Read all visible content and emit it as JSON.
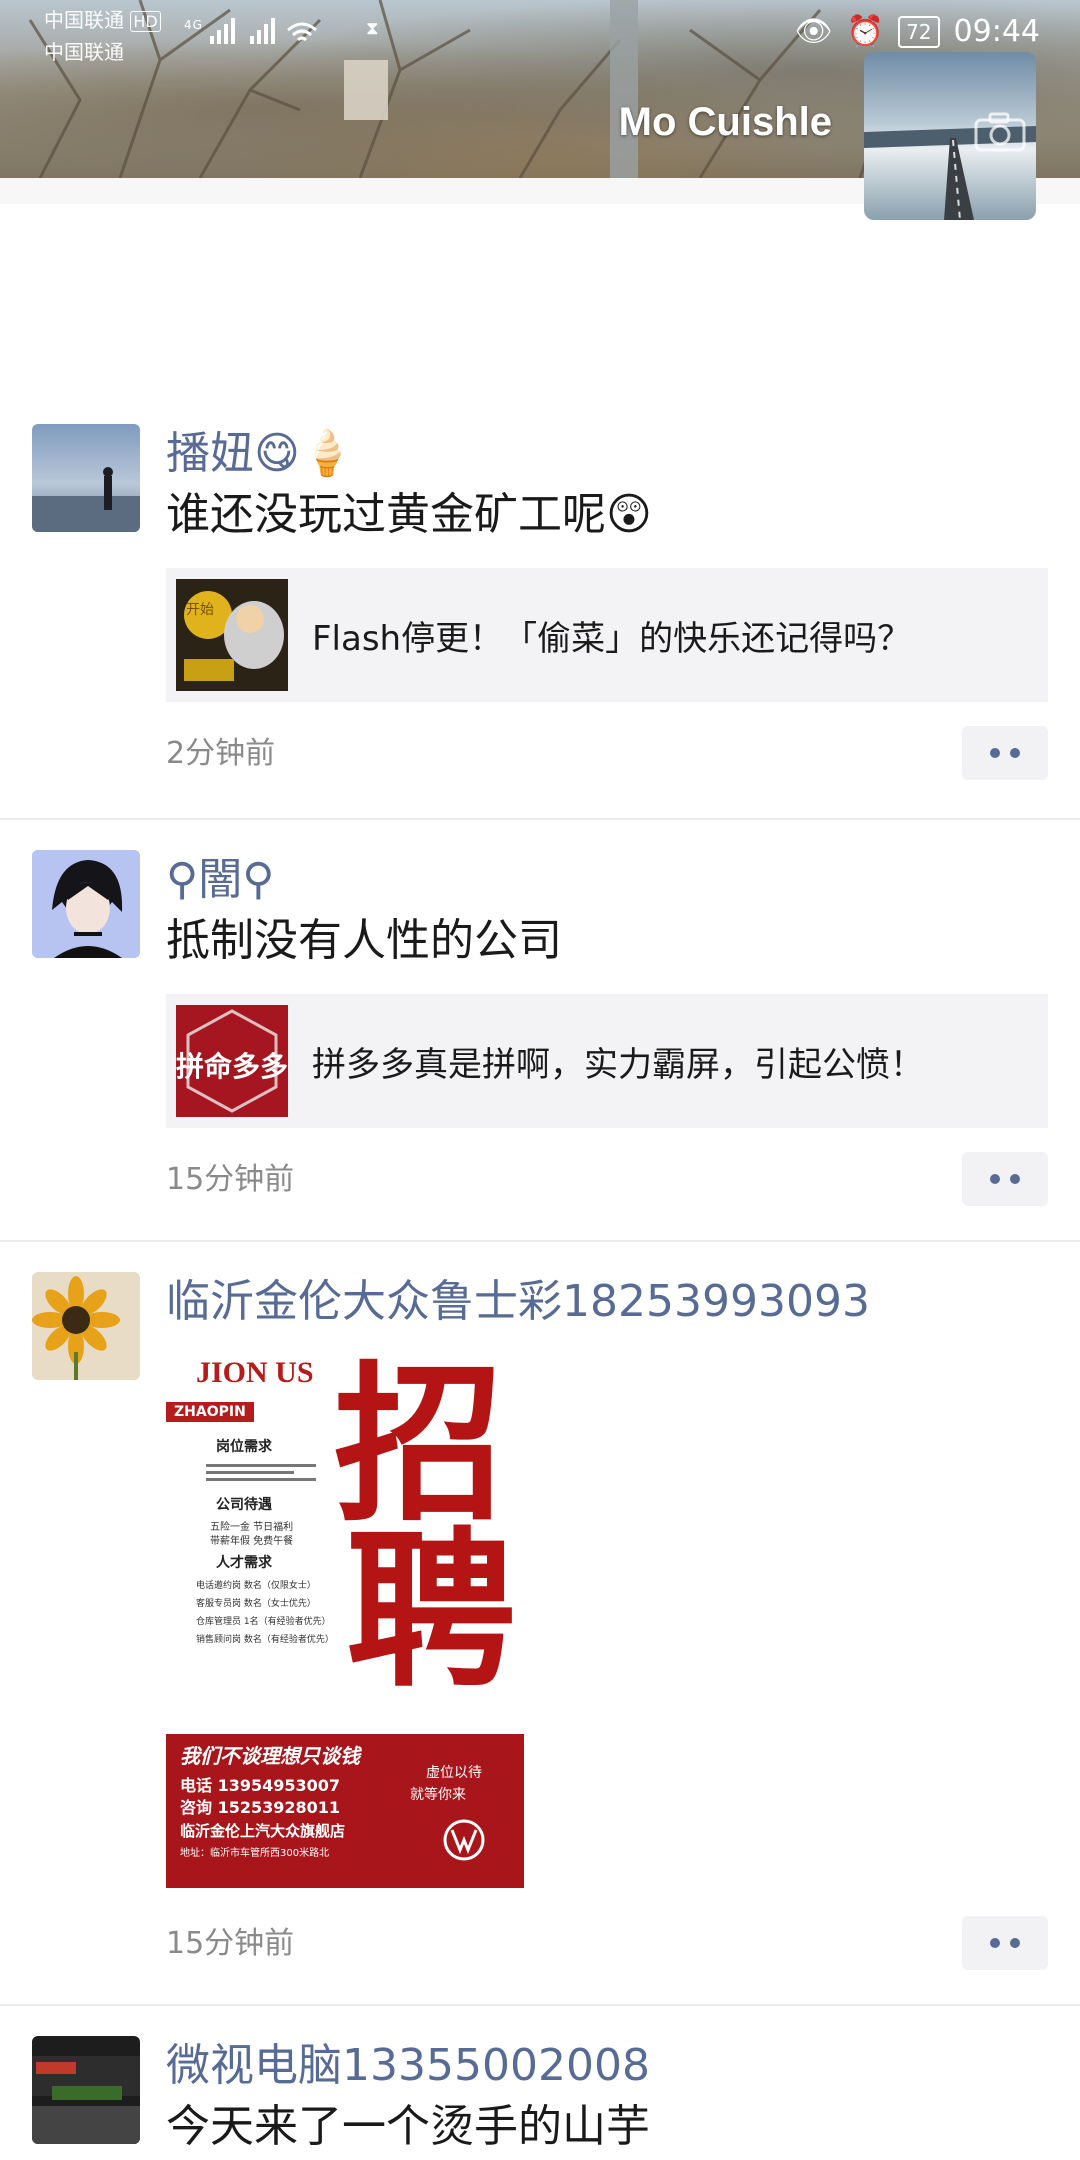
{
  "status_bar": {
    "carrier_1": "中国联通",
    "carrier_1_badge": "HD",
    "carrier_2": "中国联通",
    "signal_label": "4G",
    "battery": "72",
    "time": "09:44"
  },
  "profile": {
    "name": "Mo Cuishle"
  },
  "posts": [
    {
      "nickname": "播妞😋🍦",
      "text": "谁还没玩过黄金矿工呢😲",
      "share_title": "Flash停更！「偷菜」的快乐还记得吗？",
      "thumb_label": "开始",
      "time": "2分钟前"
    },
    {
      "nickname": "⚲闇⚲",
      "text": "抵制没有人性的公司",
      "share_title": "拼多多真是拼啊，实力霸屏，引起公愤！",
      "thumb_label": "拼命多多",
      "time": "15分钟前"
    },
    {
      "nickname": "临沂金伦大众鲁士彩18253993093",
      "poster": {
        "title_en": "JION US",
        "tag": "ZHAOPIN",
        "big_1": "招",
        "big_2": "聘",
        "section_1": "岗位需求",
        "section_2": "公司待遇",
        "benefit_1": "五险一金 节日福利",
        "benefit_2": "带薪年假 免费午餐",
        "section_3": "人才需求",
        "need_1": "电话邀约岗 数名（仅限女士）",
        "need_2": "客服专员岗 数名（女士优先）",
        "need_3": "仓库管理员 1名（有经验者优先）",
        "need_4": "销售顾问岗 数名（有经验者优先）",
        "slogan": "我们不谈理想只谈钱",
        "phone_1": "电话 13954953007",
        "phone_2": "咨询 15253928011",
        "side_1": "虚位以待",
        "side_2": "就等你来",
        "store": "临沂金伦上汽大众旗舰店",
        "address": "地址：临沂市车管所西300米路北"
      },
      "time": "15分钟前"
    },
    {
      "nickname": "微视电脑13355002008",
      "text": "今天来了一个烫手的山芋"
    }
  ]
}
